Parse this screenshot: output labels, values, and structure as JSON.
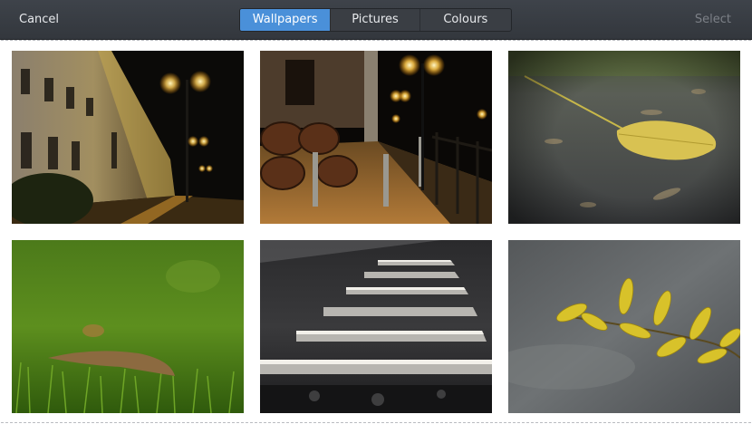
{
  "header": {
    "cancel_label": "Cancel",
    "select_label": "Select",
    "tabs": [
      {
        "label": "Wallpapers",
        "active": true
      },
      {
        "label": "Pictures",
        "active": false
      },
      {
        "label": "Colours",
        "active": false
      }
    ]
  },
  "colors": {
    "header_bg": "#393d43",
    "accent": "#4a90d9",
    "select_disabled": "#7c8087"
  },
  "wallpapers": [
    {
      "subject": "night-street-building"
    },
    {
      "subject": "night-barrels-street"
    },
    {
      "subject": "leaf-on-asphalt"
    },
    {
      "subject": "leaf-in-grass"
    },
    {
      "subject": "railway-track"
    },
    {
      "subject": "yellow-leaves-branch"
    }
  ]
}
